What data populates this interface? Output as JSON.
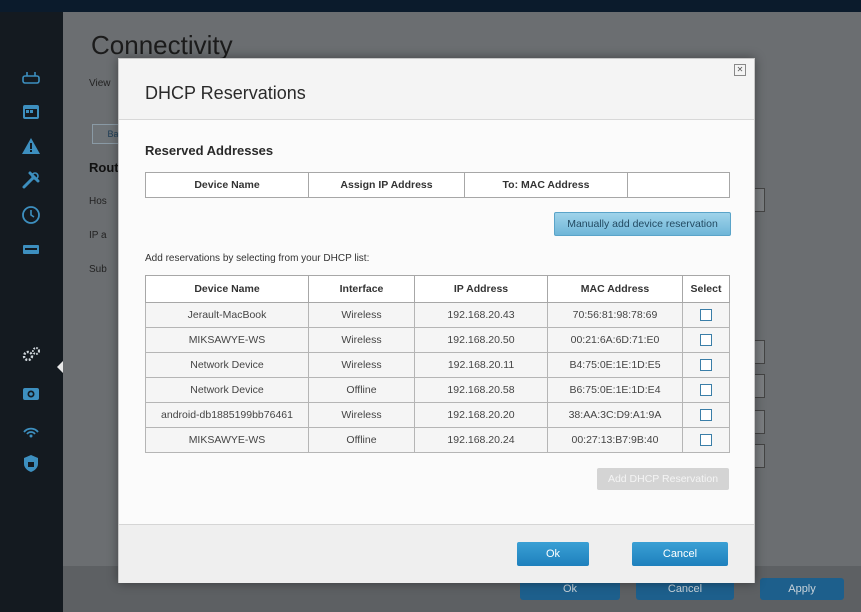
{
  "background": {
    "title": "Connectivity",
    "subtitle": "View",
    "tab_label": "Ba",
    "section": "Rout",
    "labels": [
      "Hos",
      "IP a",
      "Sub"
    ],
    "footer_buttons": {
      "ok": "Ok",
      "cancel": "Cancel",
      "apply": "Apply"
    }
  },
  "sidebar": {
    "icons": [
      "router-icon",
      "calendar-icon",
      "warning-icon",
      "tools-icon",
      "clock-icon",
      "network-icon",
      "settings-icon",
      "camera-icon",
      "wifi-icon",
      "shield-icon"
    ]
  },
  "modal": {
    "title": "DHCP Reservations",
    "reserved_heading": "Reserved Addresses",
    "reserved_columns": [
      "Device Name",
      "Assign IP Address",
      "To: MAC Address",
      ""
    ],
    "manual_button": "Manually add device reservation",
    "hint": "Add reservations by selecting from your DHCP list:",
    "dhcp_columns": [
      "Device Name",
      "Interface",
      "IP Address",
      "MAC Address",
      "Select"
    ],
    "dhcp_rows": [
      {
        "name": "Jerault-MacBook",
        "interface": "Wireless",
        "ip": "192.168.20.43",
        "mac": "70:56:81:98:78:69"
      },
      {
        "name": "MIKSAWYE-WS",
        "interface": "Wireless",
        "ip": "192.168.20.50",
        "mac": "00:21:6A:6D:71:E0"
      },
      {
        "name": "Network Device",
        "interface": "Wireless",
        "ip": "192.168.20.11",
        "mac": "B4:75:0E:1E:1D:E5"
      },
      {
        "name": "Network Device",
        "interface": "Offline",
        "ip": "192.168.20.58",
        "mac": "B6:75:0E:1E:1D:E4"
      },
      {
        "name": "android-db1885199bb76461",
        "interface": "Wireless",
        "ip": "192.168.20.20",
        "mac": "38:AA:3C:D9:A1:9A"
      },
      {
        "name": "MIKSAWYE-WS",
        "interface": "Offline",
        "ip": "192.168.20.24",
        "mac": "00:27:13:B7:9B:40"
      }
    ],
    "add_button": "Add DHCP Reservation",
    "ok_button": "Ok",
    "cancel_button": "Cancel"
  }
}
